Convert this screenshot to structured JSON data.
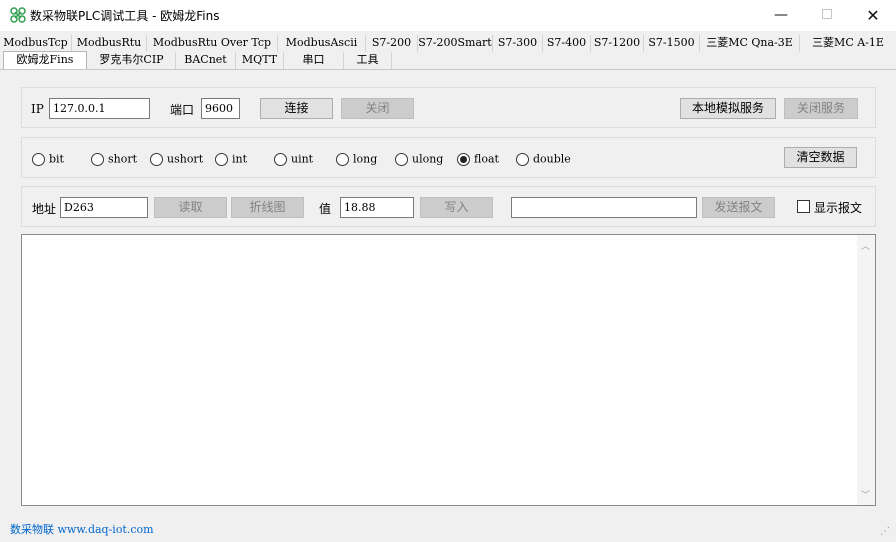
{
  "window": {
    "title": "数采物联PLC调试工具 - 欧姆龙Fins",
    "minimize_glyph": "—",
    "close_glyph": "✕",
    "icon": "app-logo-icon"
  },
  "tabs_row1": [
    "ModbusTcp",
    "ModbusRtu",
    "ModbusRtu Over Tcp",
    "ModbusAscii",
    "S7-200",
    "S7-200Smart",
    "S7-300",
    "S7-400",
    "S7-1200",
    "S7-1500",
    "三菱MC Qna-3E",
    "三菱MC A-1E"
  ],
  "tabs_row2": [
    "欧姆龙Fins",
    "罗克韦尔CIP",
    "BACnet",
    "MQTT",
    "串口",
    "工具"
  ],
  "selected_tab": "欧姆龙Fins",
  "connection": {
    "ip_label": "IP",
    "ip_value": "127.0.0.1",
    "port_label": "端口",
    "port_value": "9600",
    "connect_label": "连接",
    "close_label": "关闭",
    "local_sim_label": "本地模拟服务",
    "stop_service_label": "关闭服务"
  },
  "datatypes": {
    "options": [
      "bit",
      "short",
      "ushort",
      "int",
      "uint",
      "long",
      "ulong",
      "float",
      "double"
    ],
    "selected": "float",
    "clear_label": "清空数据"
  },
  "io": {
    "address_label": "地址",
    "address_value": "D263",
    "read_label": "读取",
    "chart_label": "折线图",
    "value_label": "值",
    "value_value": "18.88",
    "write_label": "写入",
    "message_value": "",
    "send_label": "发送报文",
    "show_message_label": "显示报文",
    "show_message_checked": false
  },
  "log": {
    "content": "",
    "scroll_up": "︿",
    "scroll_down": "﹀"
  },
  "status": {
    "company": "数采物联",
    "url": "www.daq-iot.com",
    "grip": "⋰"
  }
}
